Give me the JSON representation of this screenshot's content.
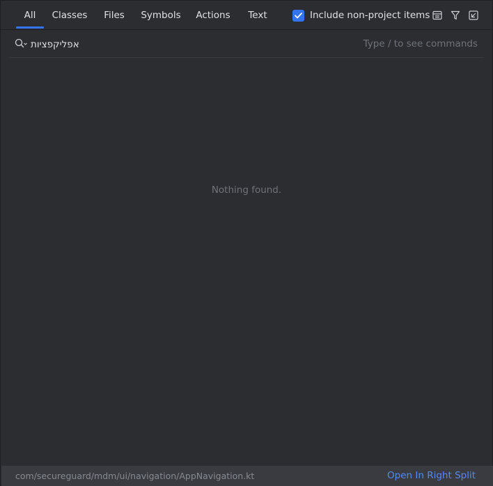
{
  "tabs": [
    {
      "label": "All",
      "active": true
    },
    {
      "label": "Classes"
    },
    {
      "label": "Files"
    },
    {
      "label": "Symbols"
    },
    {
      "label": "Actions"
    },
    {
      "label": "Text"
    }
  ],
  "include_option": {
    "label": "Include non-project items",
    "checked": true
  },
  "toolbar_icons": [
    "preview-icon",
    "filter-icon",
    "open-in-find-tool-window-icon"
  ],
  "search": {
    "value": "אפליקפציות",
    "hint": "Type / to see commands"
  },
  "results": {
    "empty_text": "Nothing found."
  },
  "footer": {
    "path": "com/secureguard/mdm/ui/navigation/AppNavigation.kt",
    "action_label": "Open In Right Split"
  },
  "colors": {
    "accent": "#3574f0",
    "link": "#548af7",
    "background": "#2b2d30"
  }
}
